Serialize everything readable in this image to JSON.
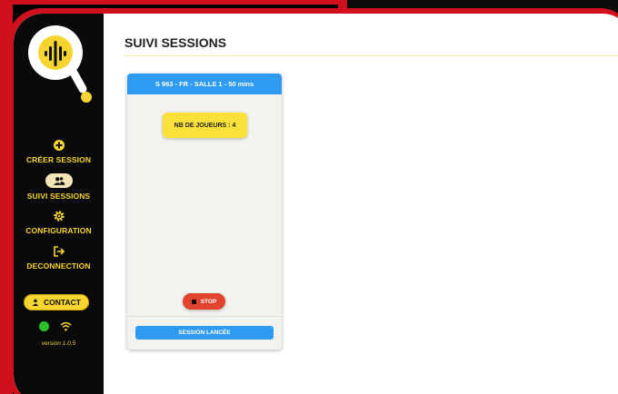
{
  "page": {
    "title": "SUIVI SESSIONS"
  },
  "sidebar": {
    "items": [
      {
        "label": "CRÉER SESSION",
        "icon": "plus-circle-icon"
      },
      {
        "label": "SUIVI SESSIONS",
        "icon": "users-icon"
      },
      {
        "label": "CONFIGURATION",
        "icon": "gear-icon"
      },
      {
        "label": "DECONNECTION",
        "icon": "logout-icon"
      }
    ],
    "contact_label": "CONTACT",
    "version": "version 1.0.5"
  },
  "session_card": {
    "header": "S 963 - FR - SALLE 1 - 50 mins",
    "players": "NB DE JOUEURS : 4",
    "stop_label": "STOP",
    "status": "SESSION LANCÉE"
  },
  "colors": {
    "brand_yellow": "#f7d531",
    "frame_red": "#d0111d",
    "accent_blue": "#2f9bf0",
    "stop_red": "#e2432f",
    "online_green": "#2bbf2b"
  }
}
